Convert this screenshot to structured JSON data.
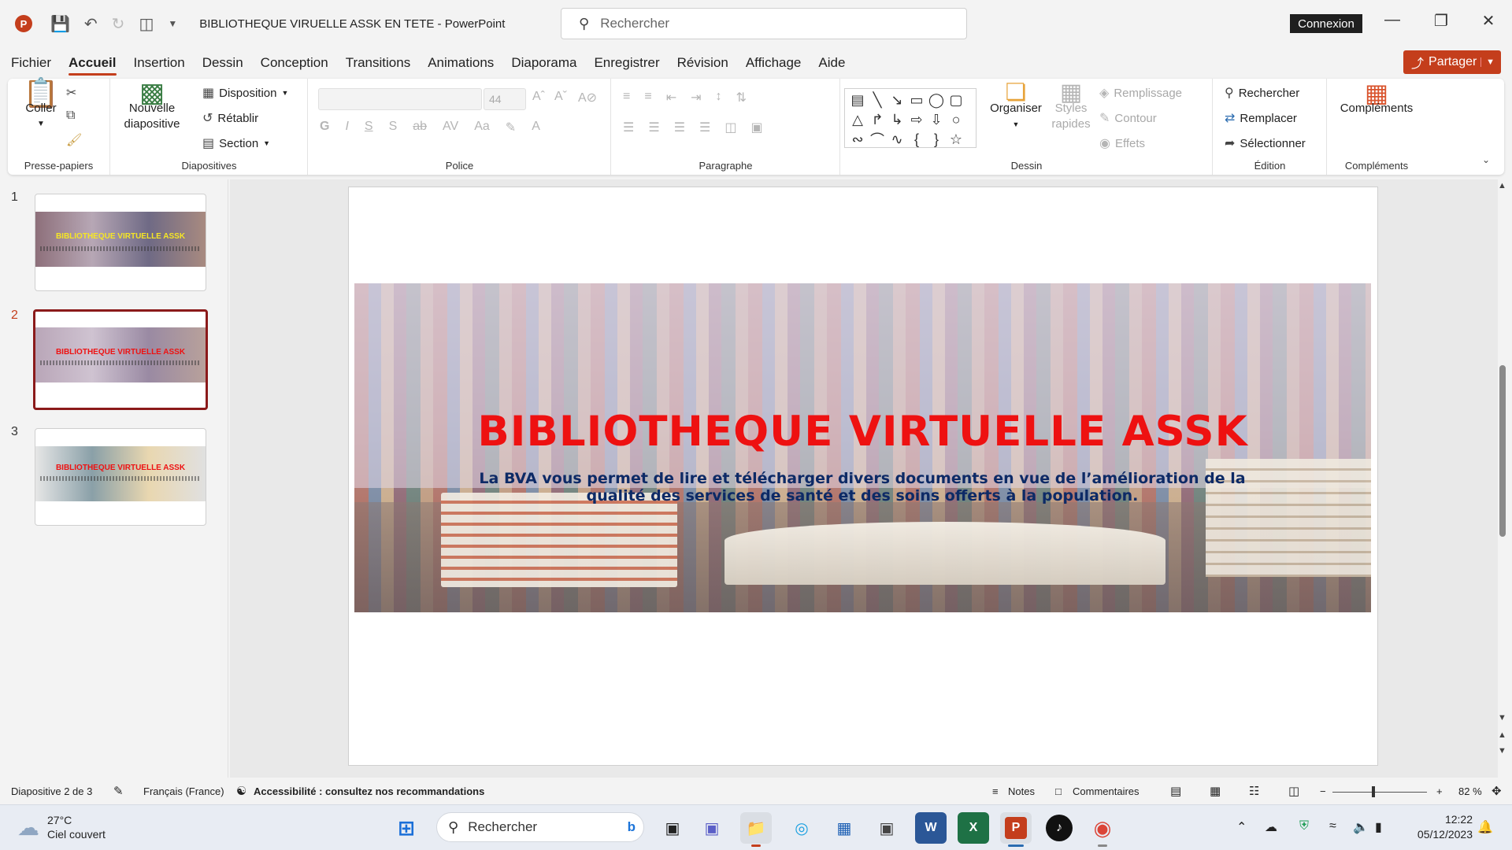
{
  "titlebar": {
    "app_icon": "P",
    "doc_title": "BIBLIOTHEQUE VIRUELLE ASSK EN TETE  -  PowerPoint",
    "search_placeholder": "Rechercher",
    "connexion": "Connexion",
    "qat_icons": [
      "save-icon",
      "undo-icon",
      "redo-icon",
      "present-icon",
      "customize-icon"
    ]
  },
  "menu": {
    "tabs": [
      "Fichier",
      "Accueil",
      "Insertion",
      "Dessin",
      "Conception",
      "Transitions",
      "Animations",
      "Diaporama",
      "Enregistrer",
      "Révision",
      "Affichage",
      "Aide"
    ],
    "active": "Accueil",
    "share": "Partager"
  },
  "ribbon": {
    "clipboard": {
      "paste": "Coller",
      "label": "Presse-papiers"
    },
    "slides": {
      "new_slide_1": "Nouvelle",
      "new_slide_2": "diapositive",
      "layout": "Disposition",
      "reset": "Rétablir",
      "section": "Section",
      "label": "Diapositives"
    },
    "font": {
      "font_size": "44",
      "label": "Police"
    },
    "paragraph": {
      "label": "Paragraphe"
    },
    "drawing": {
      "arrange": "Organiser",
      "quick_styles_1": "Styles",
      "quick_styles_2": "rapides",
      "fill": "Remplissage",
      "outline": "Contour",
      "effects": "Effets",
      "label": "Dessin"
    },
    "editing": {
      "find": "Rechercher",
      "replace": "Remplacer",
      "select": "Sélectionner",
      "label": "Édition"
    },
    "addins": {
      "button": "Compléments",
      "label": "Compléments"
    }
  },
  "thumbnails": [
    {
      "num": "1",
      "title": "BIBLIOTHEQUE VIRTUELLE ASSK",
      "title_color": "#f5e625"
    },
    {
      "num": "2",
      "title": "BIBLIOTHEQUE VIRTUELLE ASSK",
      "title_color": "#ee1111"
    },
    {
      "num": "3",
      "title": "BIBLIOTHEQUE VIRTUELLE ASSK",
      "title_color": "#ee1111"
    }
  ],
  "selected_slide": 2,
  "slide": {
    "title": "BIBLIOTHEQUE VIRTUELLE ASSK",
    "subtitle": "La BVA vous permet de lire et télécharger divers documents en vue de l’amélioration de la qualité des services de santé et des soins offerts à la population.",
    "title_color": "#ee1111",
    "subtitle_color": "#0d2a66"
  },
  "statusbar": {
    "slide_info": "Diapositive 2 de 3",
    "language": "Français (France)",
    "accessibility": "Accessibilité : consultez nos recommandations",
    "notes": "Notes",
    "comments": "Commentaires",
    "zoom": "82 %"
  },
  "taskbar": {
    "temperature": "27°C",
    "weather": "Ciel couvert",
    "search": "Rechercher",
    "time": "12:22",
    "date": "05/12/2023"
  },
  "colors": {
    "accent": "#c43e1c",
    "selected_border": "#8b1a1a"
  }
}
